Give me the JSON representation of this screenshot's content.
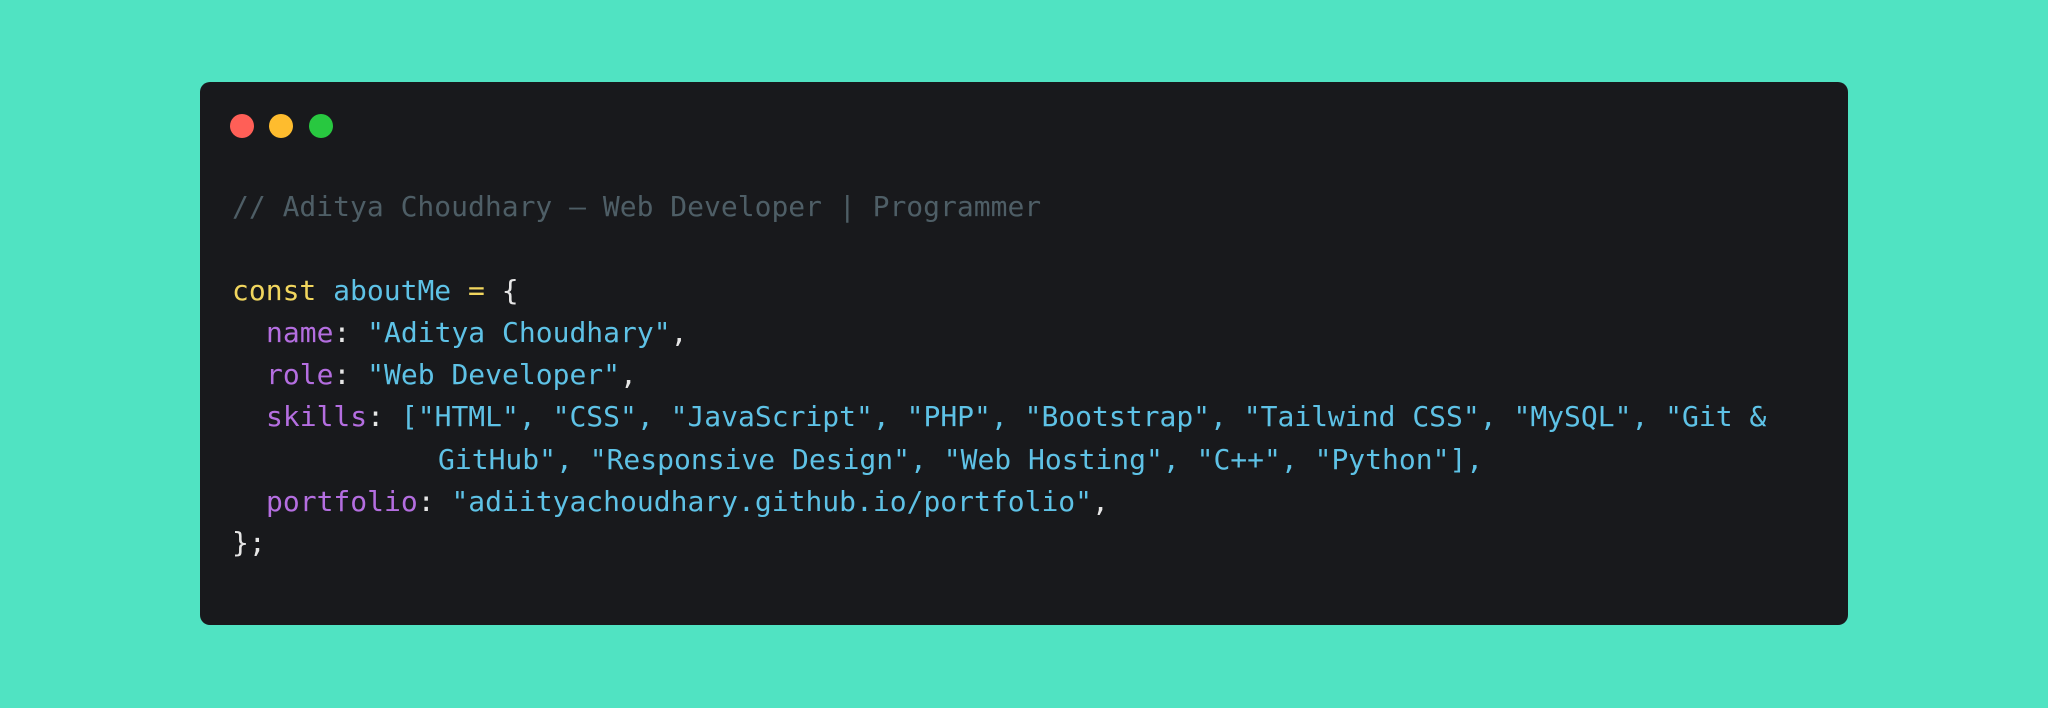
{
  "background_color": "#50e3c2",
  "window": {
    "background_color": "#18191c",
    "buttons": {
      "close_color": "#ff5f57",
      "minimize_color": "#febc2e",
      "maximize_color": "#28c840"
    }
  },
  "code": {
    "comment": "// Aditya Choudhary — Web Developer | Programmer",
    "decl_keyword": "const",
    "decl_name": "aboutMe",
    "decl_equals": "=",
    "decl_open": "{",
    "name_key": "name",
    "name_value": "\"Aditya Choudhary\"",
    "role_key": "role",
    "role_value": "\"Web Developer\"",
    "skills_key": "skills",
    "skills_line1": "[\"HTML\", \"CSS\", \"JavaScript\", \"PHP\", \"Bootstrap\", \"Tailwind CSS\", \"MySQL\", \"Git &",
    "skills_line2": "GitHub\", \"Responsive Design\", \"Web Hosting\", \"C++\", \"Python\"],",
    "portfolio_key": "portfolio",
    "portfolio_value": "\"adiityachoudhary.github.io/portfolio\"",
    "close": "};",
    "colon": ":",
    "comma": ","
  }
}
